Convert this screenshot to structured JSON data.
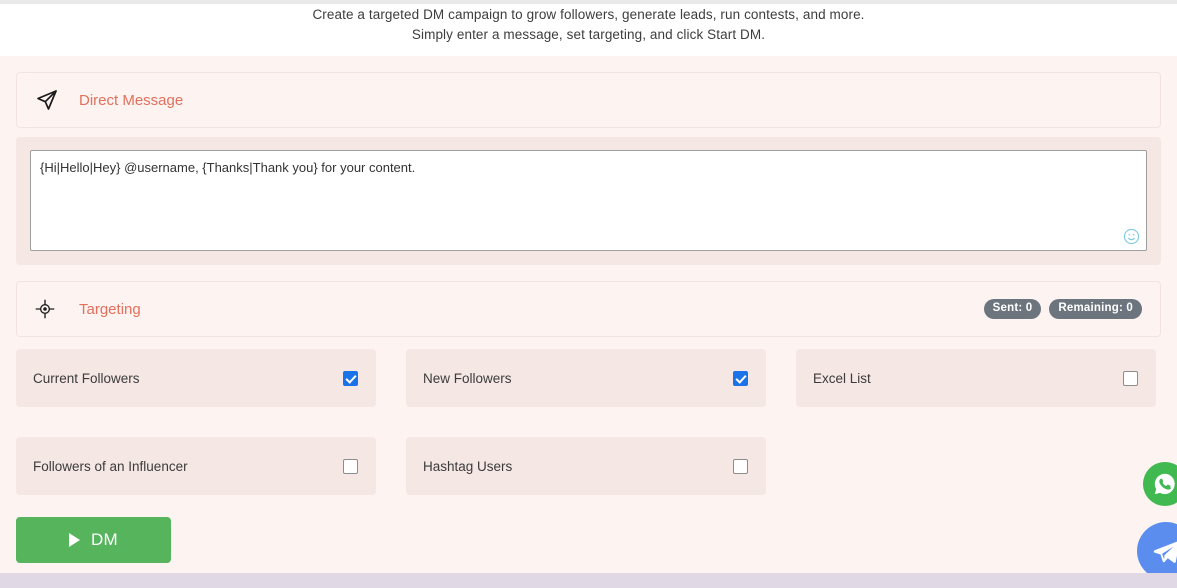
{
  "intro": {
    "line1": "Create a targeted DM campaign to grow followers, generate leads, run contests, and more.",
    "line2": "Simply enter a message, set targeting, and click Start DM."
  },
  "direct_message": {
    "title": "Direct Message",
    "icon": "paper-plane-icon",
    "message_value": "{Hi|Hello|Hey} @username, {Thanks|Thank you} for your content.",
    "message_placeholder": "",
    "emoji_icon": "smiley-face-icon"
  },
  "targeting": {
    "title": "Targeting",
    "icon": "crosshair-icon",
    "badges": [
      {
        "name": "sent-badge",
        "label": "Sent: 0"
      },
      {
        "name": "remaining-badge",
        "label": "Remaining: 0"
      }
    ],
    "options": [
      {
        "label": "Current Followers",
        "checked": true
      },
      {
        "label": "New Followers",
        "checked": true
      },
      {
        "label": "Excel List",
        "checked": false
      },
      {
        "label": "Followers of an Influencer",
        "checked": false
      },
      {
        "label": "Hashtag Users",
        "checked": false
      }
    ]
  },
  "start_button": {
    "label": "DM",
    "icon": "play-icon"
  },
  "floating": [
    {
      "name": "whatsapp-fab",
      "icon": "whatsapp-icon"
    },
    {
      "name": "telegram-fab",
      "icon": "telegram-icon"
    }
  ],
  "colors": {
    "page_background": "#fdf3f1",
    "panel_background": "#f4e7e4",
    "accent_title": "#e2705c",
    "checkbox_checked": "#1a73e8",
    "start_button": "#56b45d",
    "badge": "#6c757d",
    "bottom_bar": "#e1d8e6",
    "whatsapp": "#3fb950",
    "telegram": "#5b8def"
  }
}
